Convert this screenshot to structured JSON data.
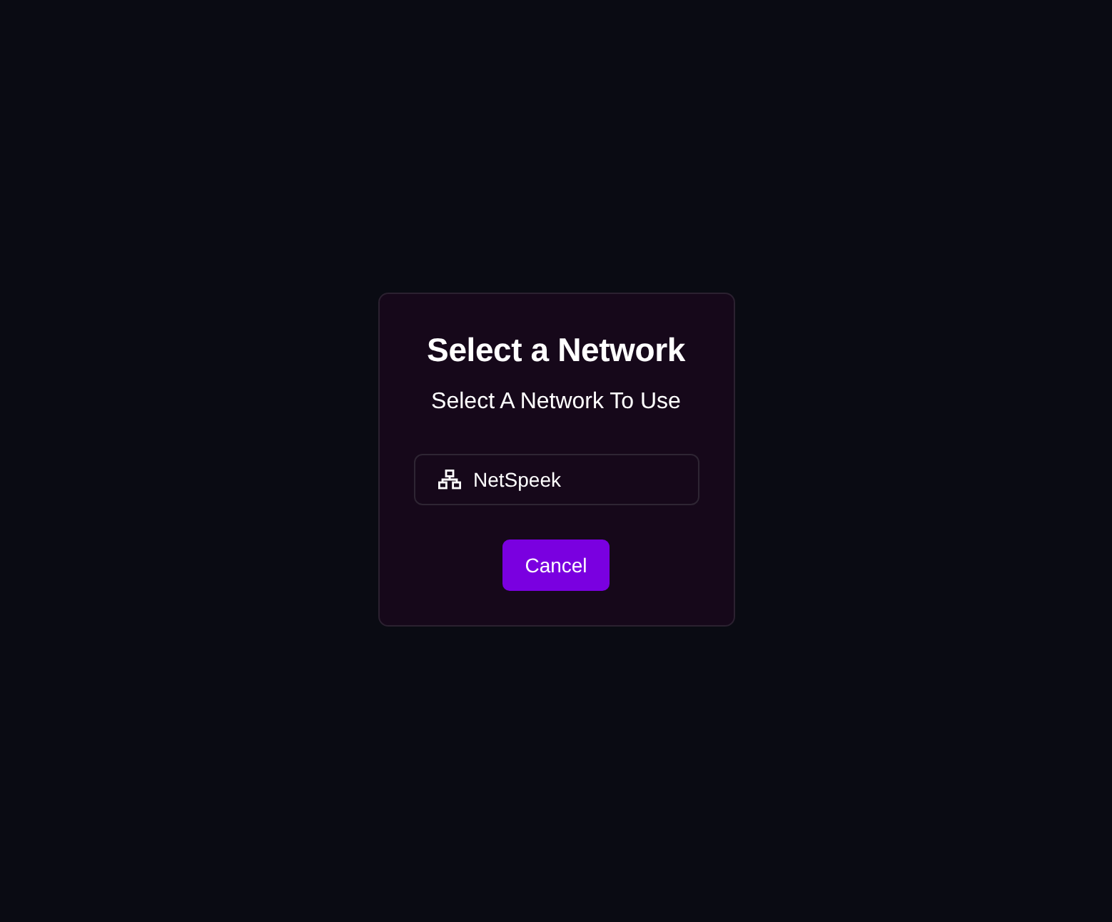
{
  "dialog": {
    "title": "Select a Network",
    "subtitle": "Select A Network To Use",
    "networks": [
      {
        "name": "NetSpeek"
      }
    ],
    "buttons": [
      "Cancel"
    ]
  }
}
